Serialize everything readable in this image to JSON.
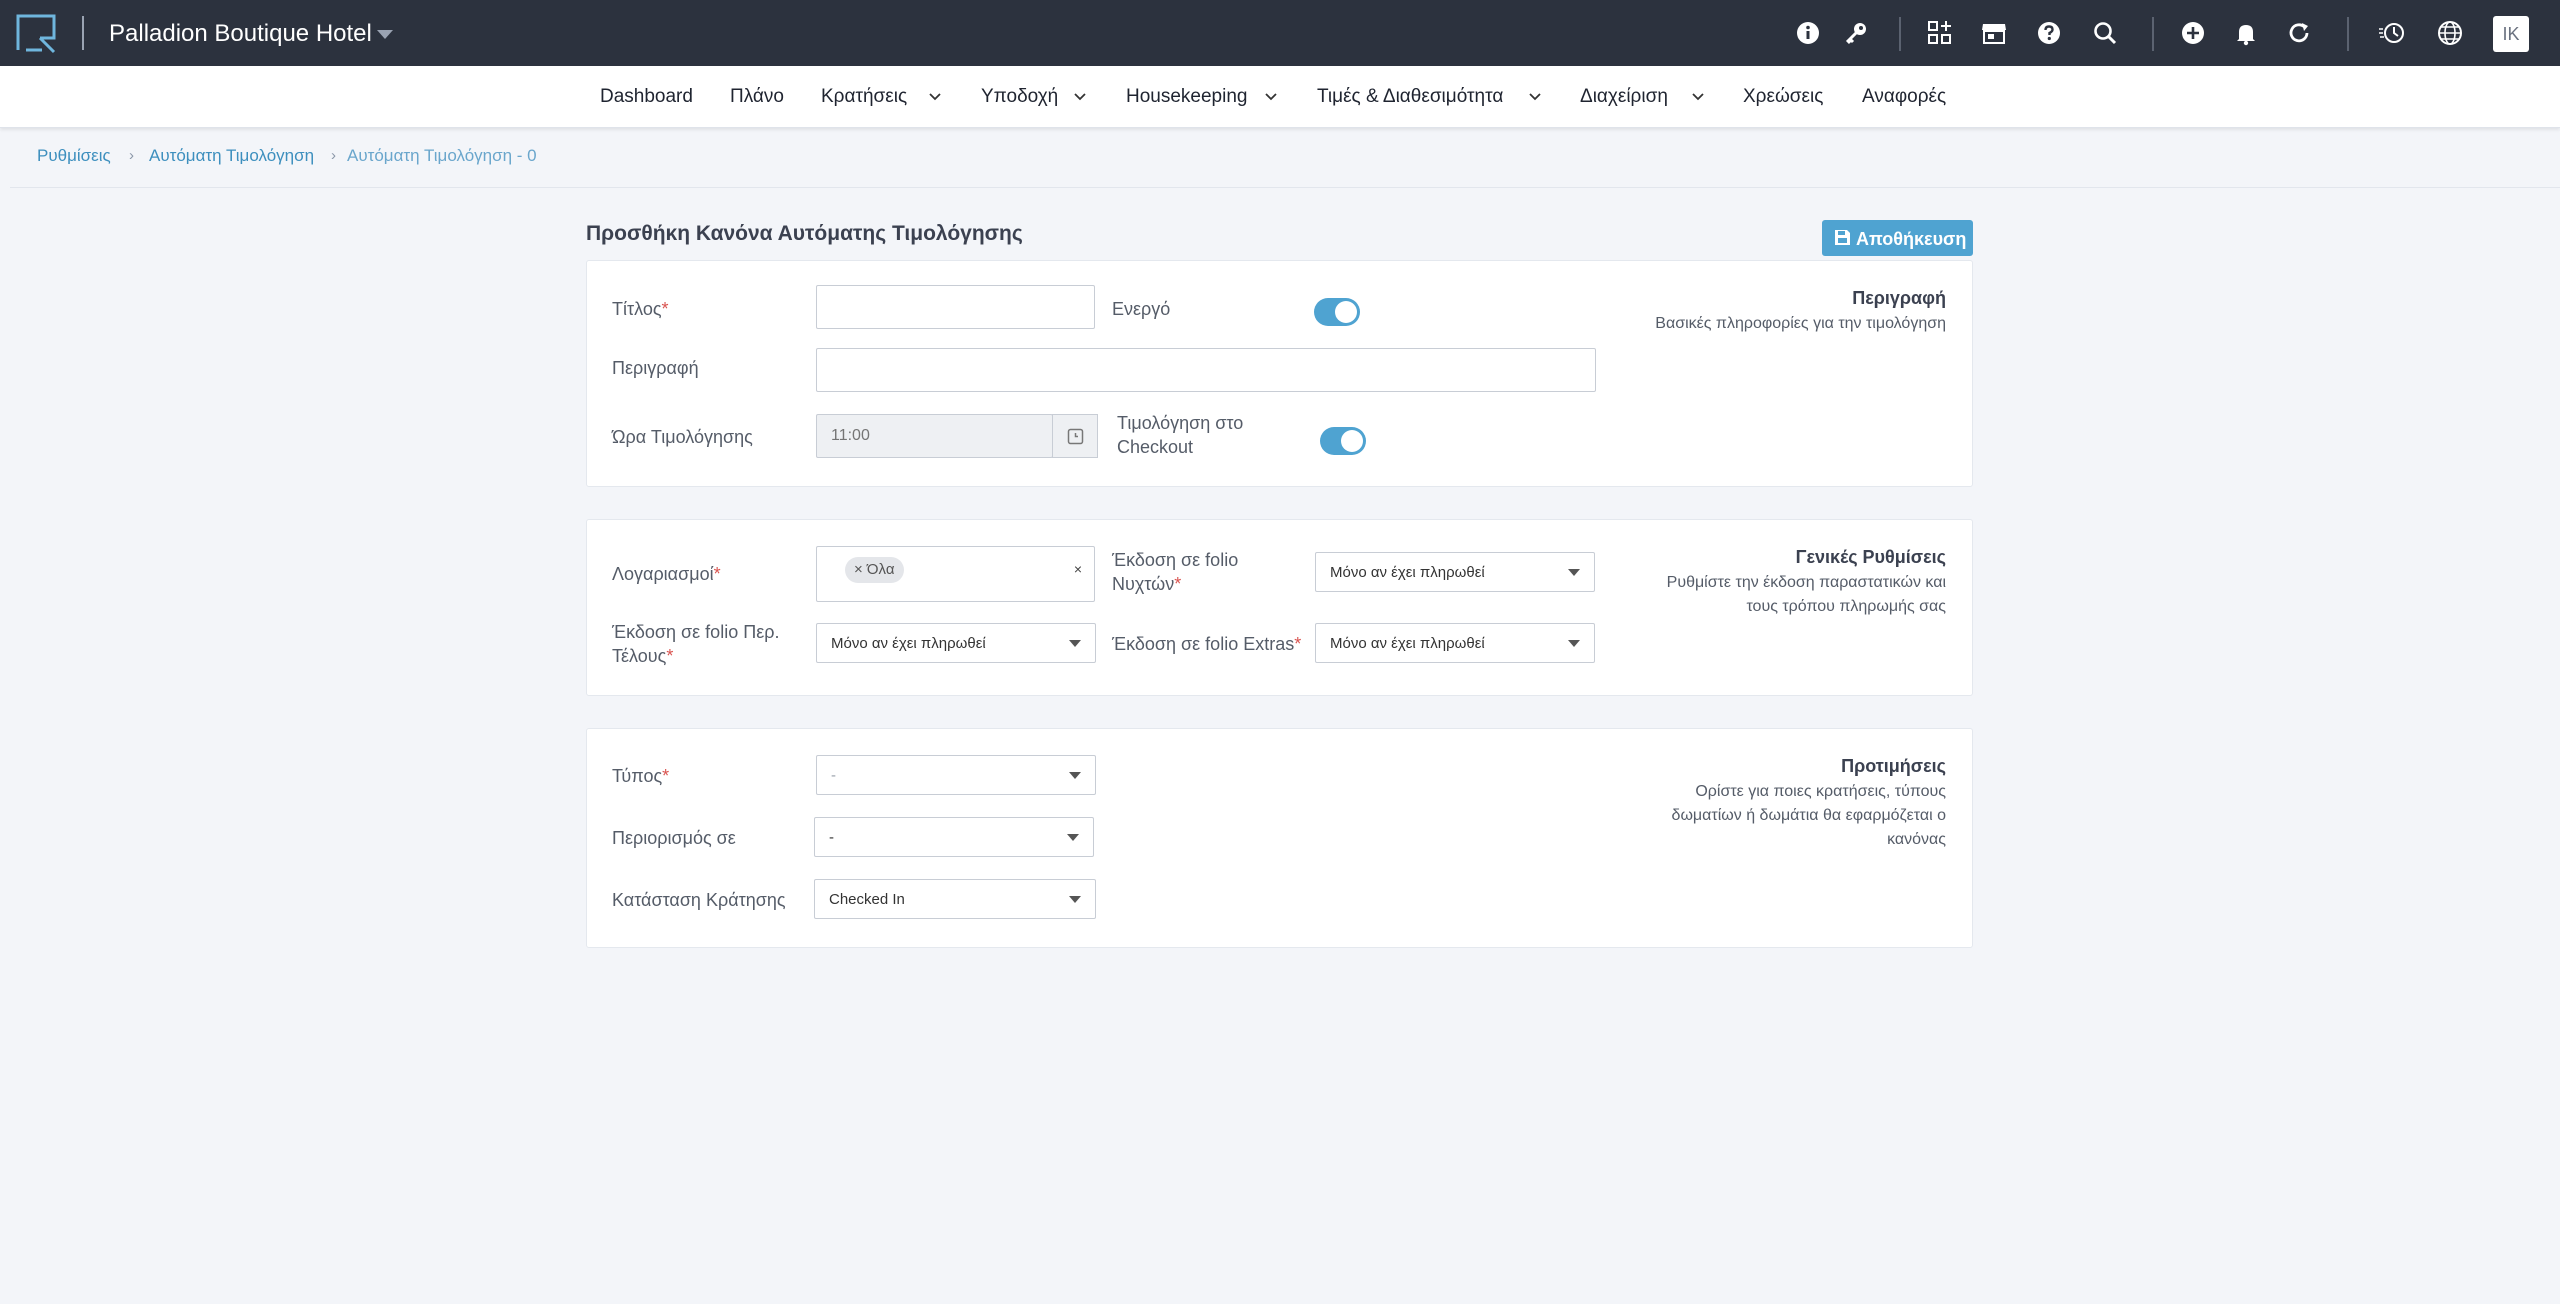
{
  "header": {
    "hotel_name": "Palladion Boutique Hotel",
    "user_initials": "IK",
    "icons": [
      "info-icon",
      "key-icon",
      "apps-add-icon",
      "store-icon",
      "help-icon",
      "search-icon",
      "add-circle-icon",
      "bell-icon",
      "refresh-icon",
      "history-icon",
      "globe-icon"
    ]
  },
  "nav": {
    "dashboard": "Dashboard",
    "plan": "Πλάνο",
    "reservations": "Κρατήσεις",
    "reception": "Υποδοχή",
    "housekeeping": "Housekeeping",
    "rates": "Τιμές & Διαθεσιμότητα",
    "management": "Διαχείριση",
    "charges": "Χρεώσεις",
    "reports": "Αναφορές"
  },
  "breadcrumb": {
    "settings": "Ρυθμίσεις",
    "auto_invoicing": "Αυτόματη Τιμολόγηση",
    "current": "Αυτόματη Τιμολόγηση - 0",
    "separator": "›"
  },
  "page": {
    "title": "Προσθήκη Κανόνα Αυτόματης Τιμολόγησης",
    "save_label": "Αποθήκευση"
  },
  "section_description": {
    "title_label": "Τίτλος",
    "title_value": "",
    "active_label": "Ενεργό",
    "active": true,
    "description_label": "Περιγραφή",
    "description_value": "",
    "time_label": "Ώρα Τιμολόγησης",
    "time_placeholder": "11:00",
    "checkout_label_1": "Τιμολόγηση στο",
    "checkout_label_2": "Checkout",
    "checkout_invoicing": true,
    "side_title": "Περιγραφή",
    "side_desc": "Βασικές πληροφορίες για την τιμολόγηση"
  },
  "section_general": {
    "accounts_label": "Λογαριασμοί",
    "accounts_chip": "× Όλα",
    "clear": "×",
    "nights_label_1": "Έκδοση σε folio",
    "nights_label_2": "Νυχτών",
    "nights_value": "Μόνο αν έχει πληρωθεί",
    "tax_label_1": "Έκδοση σε folio Περ.",
    "tax_label_2": "Τέλους",
    "tax_value": "Μόνο αν έχει πληρωθεί",
    "extras_label": "Έκδοση σε folio Extras",
    "extras_value": "Μόνο αν έχει πληρωθεί",
    "side_title": "Γενικές Ρυθμίσεις",
    "side_desc_1": "Ρυθμίστε την έκδοση παραστατικών και",
    "side_desc_2": "τους τρόπου πληρωμής σας"
  },
  "section_preferences": {
    "type_label": "Τύπος",
    "type_value": "-",
    "restriction_label": "Περιορισμός σε",
    "restriction_value": "-",
    "status_label": "Κατάσταση Κράτησης",
    "status_value": "Checked In",
    "side_title": "Προτιμήσεις",
    "side_desc_1": "Ορίστε για ποιες κρατήσεις, τύπους",
    "side_desc_2": "δωματίων ή δωμάτια θα εφαρμόζεται ο",
    "side_desc_3": "κανόνας"
  },
  "required_mark": "*",
  "colors": {
    "topbar": "#2c323e",
    "accent": "#4fa3d1",
    "link": "#3d8fbe",
    "required": "#d9534f"
  }
}
